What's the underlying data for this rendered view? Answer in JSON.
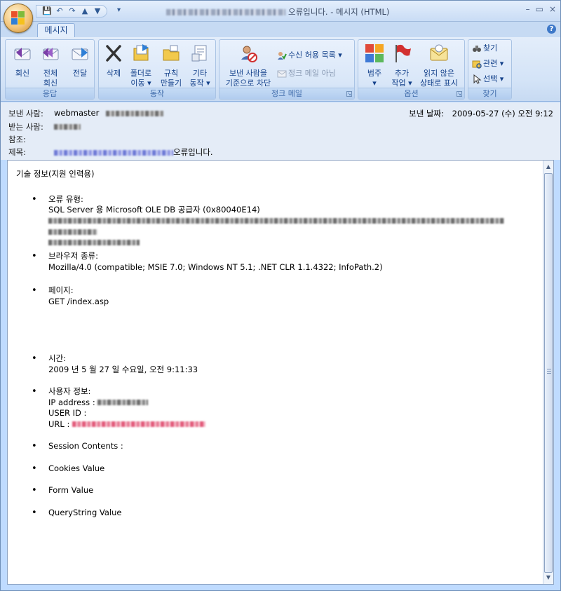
{
  "window": {
    "title_suffix": "오류입니다. - 메시지 (HTML)",
    "controls": [
      "–",
      "▭",
      "×"
    ]
  },
  "tabs": {
    "message": "메시지"
  },
  "ribbon": {
    "groups": {
      "respond": "응답",
      "actions": "동작",
      "junk": "정크 메일",
      "options": "옵션",
      "find": "찾기"
    },
    "respond": {
      "reply": "회신",
      "reply_all_1": "전체",
      "reply_all_2": "회신",
      "forward": "전달"
    },
    "actions": {
      "delete": "삭제",
      "move_1": "폴더로",
      "move_2": "이동 ▾",
      "rules_1": "규칙",
      "rules_2": "만들기",
      "other_1": "기타",
      "other_2": "동작 ▾"
    },
    "junk": {
      "block_1": "보낸 사람을",
      "block_2": "기준으로 차단",
      "safe_list": "수신 허용 목록 ▾",
      "not_junk": "정크 메일 아님"
    },
    "options": {
      "categorize": "범주",
      "categorize_arrow": "▾",
      "followup_1": "추가",
      "followup_2": "작업 ▾",
      "unread_1": "읽지 않은",
      "unread_2": "상태로 표시"
    },
    "find": {
      "find": "찾기",
      "related": "관련 ▾",
      "select": "선택 ▾"
    }
  },
  "header": {
    "from_label": "보낸 사람:",
    "from_value": "webmaster",
    "to_label": "받는 사람:",
    "cc_label": "참조:",
    "subject_label": "제목:",
    "subject_suffix": "오류입니다.",
    "sent_label": "보낸 날짜:",
    "sent_value": "2009-05-27 (수) 오전 9:12"
  },
  "body": {
    "title": "기술 정보(지원 인력용)",
    "error_type_label": "오류 유형:",
    "error_type_value": "SQL Server 용 Microsoft OLE DB 공급자 (0x80040E14)",
    "browser_label": "브라우저 종류:",
    "browser_value": "Mozilla/4.0 (compatible; MSIE 7.0; Windows NT 5.1; .NET CLR 1.1.4322; InfoPath.2)",
    "page_label": "페이지:",
    "page_value": "GET /index.asp",
    "time_label": "시간:",
    "time_value": "2009 년 5 월 27 일 수요일, 오전 9:11:33",
    "user_info_label": "사용자 정보:",
    "ip_label": "IP address :",
    "userid_label": "USER ID :",
    "url_label": "URL :",
    "session": "Session Contents :",
    "cookies": "Cookies Value",
    "form": "Form Value",
    "querystring": "QueryString Value"
  }
}
